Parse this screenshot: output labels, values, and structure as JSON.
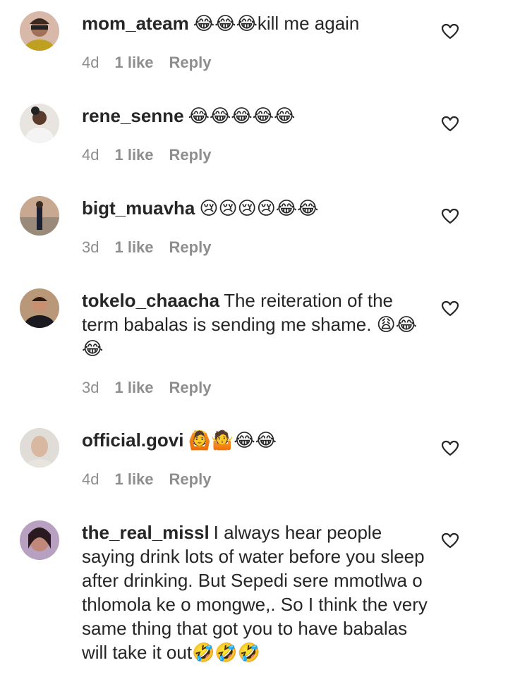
{
  "comments": [
    {
      "username": "mom_ateam",
      "text": "😂😂😂kill me again",
      "time": "4d",
      "likes": "1 like",
      "reply": "Reply"
    },
    {
      "username": "rene_senne",
      "text": "😂😂😂😂😂",
      "time": "4d",
      "likes": "1 like",
      "reply": "Reply"
    },
    {
      "username": "bigt_muavha",
      "text": "😢😢😢😢😂😂",
      "time": "3d",
      "likes": "1 like",
      "reply": "Reply"
    },
    {
      "username": "tokelo_chaacha",
      "text": "The reiteration of the term babalas is sending me shame. 😩😂😂",
      "time": "3d",
      "likes": "1 like",
      "reply": "Reply"
    },
    {
      "username": "official.govi",
      "text": "🙆🤷😂😂",
      "time": "4d",
      "likes": "1 like",
      "reply": "Reply"
    },
    {
      "username": "the_real_missl",
      "text": "I always hear people saying drink lots of water before you sleep after drinking. But Sepedi sere mmotlwa o thlomola ke o mongwe,. So I think the very same thing that got you to have babalas will take it out🤣🤣🤣",
      "time": "",
      "likes": "",
      "reply": ""
    }
  ],
  "icons": {
    "like": "heart-outline-icon"
  },
  "colors": {
    "text": "#262626",
    "meta": "#8e8e8e",
    "background": "#ffffff"
  }
}
